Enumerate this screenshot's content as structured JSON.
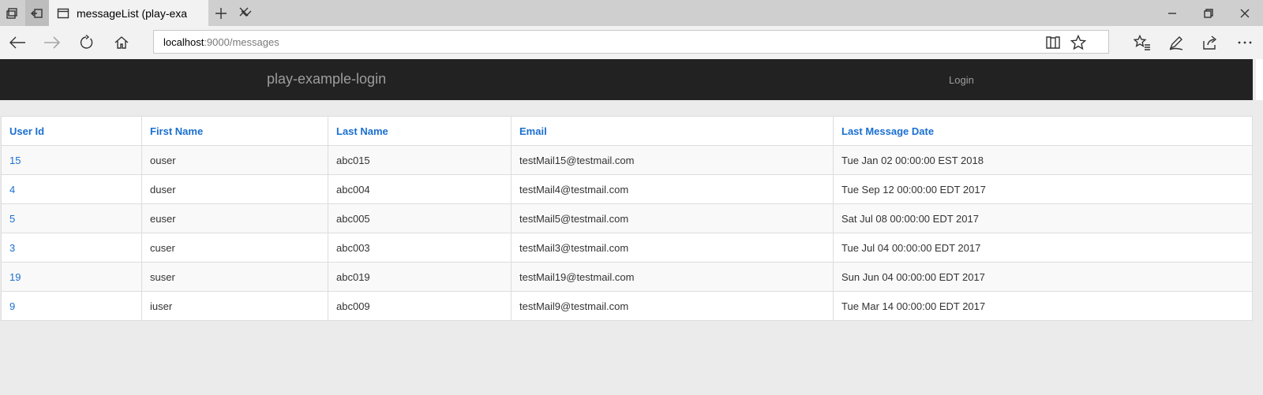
{
  "browser": {
    "tab_title": "messageList (play-exam",
    "address_host": "localhost",
    "address_path": ":9000/messages"
  },
  "app": {
    "brand": "play-example-login",
    "login_label": "Login"
  },
  "table": {
    "headers": [
      "User Id",
      "First Name",
      "Last Name",
      "Email",
      "Last Message Date"
    ],
    "rows": [
      [
        "15",
        "ouser",
        "abc015",
        "testMail15@testmail.com",
        "Tue Jan 02 00:00:00 EST 2018"
      ],
      [
        "4",
        "duser",
        "abc004",
        "testMail4@testmail.com",
        "Tue Sep 12 00:00:00 EDT 2017"
      ],
      [
        "5",
        "euser",
        "abc005",
        "testMail5@testmail.com",
        "Sat Jul 08 00:00:00 EDT 2017"
      ],
      [
        "3",
        "cuser",
        "abc003",
        "testMail3@testmail.com",
        "Tue Jul 04 00:00:00 EDT 2017"
      ],
      [
        "19",
        "suser",
        "abc019",
        "testMail19@testmail.com",
        "Sun Jun 04 00:00:00 EDT 2017"
      ],
      [
        "9",
        "iuser",
        "abc009",
        "testMail9@testmail.com",
        "Tue Mar 14 00:00:00 EDT 2017"
      ]
    ]
  },
  "colors": {
    "navbar_bg": "#222222",
    "link_blue": "#1a6fd1",
    "page_bg": "#ebebeb"
  }
}
